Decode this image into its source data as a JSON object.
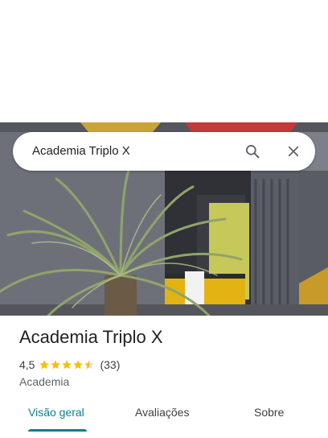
{
  "search": {
    "query": "Academia Triplo X"
  },
  "place": {
    "name": "Academia Triplo X",
    "rating": "4,5",
    "rating_fraction": 0.9,
    "review_count": "(33)",
    "category": "Academia"
  },
  "tabs": [
    {
      "label": "Visão geral",
      "active": true
    },
    {
      "label": "Avaliações",
      "active": false
    },
    {
      "label": "Sobre",
      "active": false
    }
  ],
  "colors": {
    "accent": "#0b7f8a",
    "star": "#fbbc04",
    "star_empty": "#dadce0"
  },
  "icons": {
    "search": "search-icon",
    "close": "close-icon",
    "star": "star-icon"
  }
}
